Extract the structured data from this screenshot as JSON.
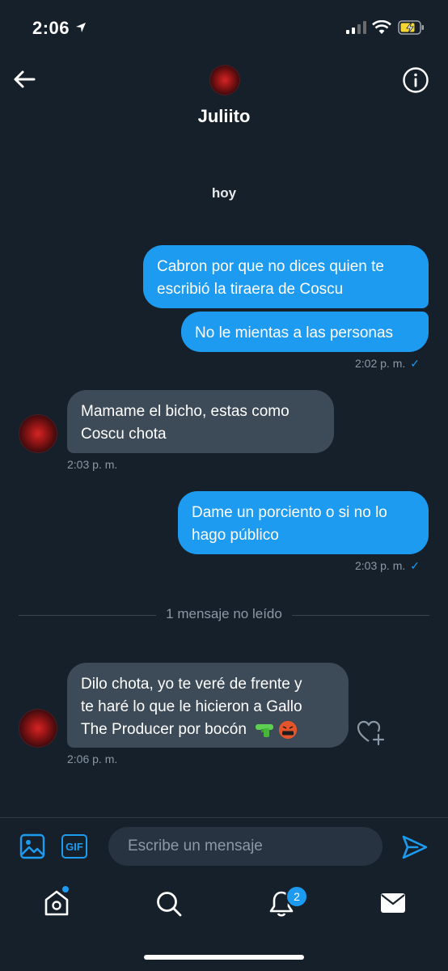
{
  "status_bar": {
    "time": "2:06"
  },
  "header": {
    "name": "Juliito"
  },
  "date_separator": "hoy",
  "messages": [
    {
      "lines": [
        "Cabron por que no dices quien te",
        "escribió la tiraera de Coscu"
      ]
    },
    {
      "lines": [
        "No le mientas a las personas"
      ]
    },
    {
      "lines": [
        "Mamame el bicho, estas como",
        "Coscu chota"
      ]
    },
    {
      "lines": [
        "Dame un porciento o si no lo",
        "hago público"
      ]
    },
    {
      "lines": [
        "Dilo chota, yo te veré de frente y",
        "te haré lo que le hicieron a Gallo",
        "The Producer por bocón"
      ]
    }
  ],
  "timestamps": {
    "t1": "2:02 p. m.",
    "t2": "2:03 p. m.",
    "t3": "2:03 p. m.",
    "t4": "2:06 p. m."
  },
  "unread_label": "1 mensaje no leído",
  "composer": {
    "gif_label": "GIF",
    "placeholder": "Escribe un mensaje"
  },
  "nav": {
    "notifications_badge": "2"
  },
  "colors": {
    "background": "#15202b",
    "accent": "#1d9bf0",
    "incoming_bubble": "#3d4a57"
  },
  "icons": [
    "back-arrow-icon",
    "info-icon",
    "image-icon",
    "gif-icon",
    "send-icon",
    "home-icon",
    "search-icon",
    "bell-icon",
    "mail-icon",
    "add-reaction-icon"
  ]
}
